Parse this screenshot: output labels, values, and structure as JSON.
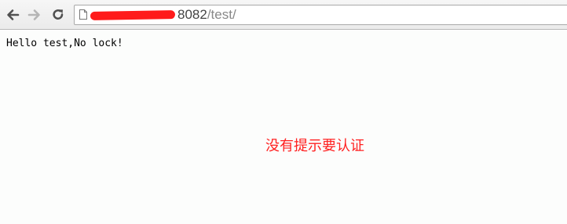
{
  "browser": {
    "url_host_tail": "8082",
    "url_path": "/test/",
    "icons": {
      "back": "back-arrow-icon",
      "forward": "forward-arrow-icon",
      "reload": "reload-icon",
      "page": "page-icon"
    },
    "redaction_color": "#ff1b1b"
  },
  "page": {
    "body_text": "Hello test,No lock!"
  },
  "annotation": {
    "text": "没有提示要认证",
    "color": "#ff2020"
  }
}
